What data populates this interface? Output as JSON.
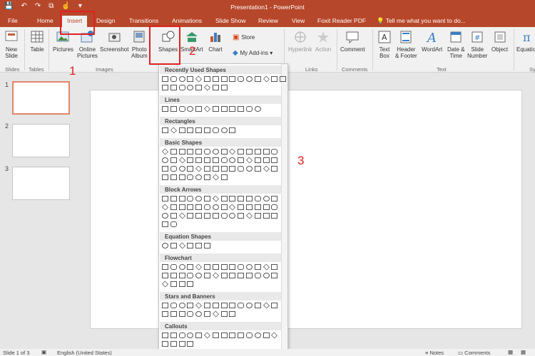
{
  "window": {
    "title": "Presentation1 - PowerPoint"
  },
  "quick_access": [
    {
      "icon": "save-icon",
      "glyph": "💾"
    },
    {
      "icon": "undo-icon",
      "glyph": "↶"
    },
    {
      "icon": "redo-icon",
      "glyph": "↷"
    },
    {
      "icon": "start-from-beginning-icon",
      "glyph": "⧉"
    },
    {
      "icon": "touch-mode-icon",
      "glyph": "☝"
    },
    {
      "icon": "customize-qat-icon",
      "glyph": "▾"
    }
  ],
  "tabs": [
    {
      "label": "File"
    },
    {
      "label": "Home"
    },
    {
      "label": "Insert"
    },
    {
      "label": "Design"
    },
    {
      "label": "Transitions"
    },
    {
      "label": "Animations"
    },
    {
      "label": "Slide Show"
    },
    {
      "label": "Review"
    },
    {
      "label": "View"
    },
    {
      "label": "Foxit Reader PDF"
    }
  ],
  "tell_me": "Tell me what you want to do...",
  "ribbon": {
    "new_slide": "New\nSlide",
    "table": "Table",
    "pictures": "Pictures",
    "online_pictures": "Online\nPictures",
    "screenshot": "Screenshot",
    "photo_album": "Photo\nAlbum",
    "shapes": "Shapes",
    "smartart": "SmartArt",
    "chart": "Chart",
    "store": "Store",
    "my_addins": "My Add-ins",
    "hyperlink": "Hyperlink",
    "action": "Action",
    "comment": "Comment",
    "text_box": "Text\nBox",
    "header_footer": "Header\n& Footer",
    "wordart": "WordArt",
    "date_time": "Date &\nTime",
    "slide_number": "Slide\nNumber",
    "object": "Object",
    "equation": "Equation",
    "groups": {
      "slides": "Slides",
      "tables": "Tables",
      "images": "Images",
      "links": "Links",
      "comments": "Comments",
      "text": "Text",
      "symbols": "Sy"
    }
  },
  "thumbnails": [
    {
      "num": "1"
    },
    {
      "num": "2"
    },
    {
      "num": "3"
    }
  ],
  "shapes_gallery": {
    "categories": [
      {
        "label": "Recently Used Shapes",
        "rows": [
          15,
          8
        ]
      },
      {
        "label": "Lines",
        "rows": [
          12
        ]
      },
      {
        "label": "Rectangles",
        "rows": [
          9
        ]
      },
      {
        "label": "Basic Shapes",
        "rows": [
          14,
          14,
          14,
          8
        ]
      },
      {
        "label": "Block Arrows",
        "rows": [
          14,
          14,
          14,
          2
        ]
      },
      {
        "label": "Equation Shapes",
        "rows": [
          6
        ]
      },
      {
        "label": "Flowchart",
        "rows": [
          14,
          14,
          4
        ]
      },
      {
        "label": "Stars and Banners",
        "rows": [
          14,
          9
        ]
      },
      {
        "label": "Callouts",
        "rows": [
          14,
          4
        ]
      }
    ]
  },
  "annotations": {
    "one": "1",
    "two": "2",
    "three": "3"
  },
  "status": {
    "slide_of": "Slide 1 of 3",
    "language": "English (United States)",
    "notes": "Notes",
    "comments": "Comments"
  },
  "colors": {
    "accent": "#b7472a",
    "highlight": "#e02020"
  }
}
